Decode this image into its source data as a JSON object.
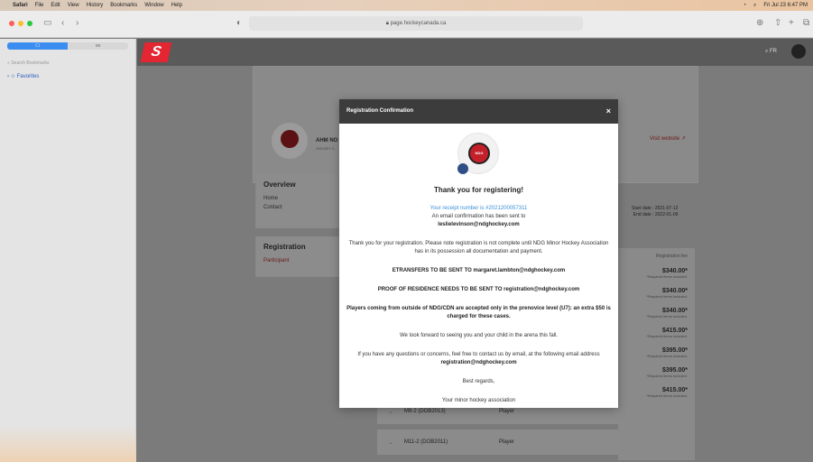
{
  "menubar": {
    "apple": "",
    "app_name": "Safari",
    "items": [
      "File",
      "Edit",
      "View",
      "History",
      "Bookmarks",
      "Window",
      "Help"
    ],
    "datetime": "Fri Jul 23  6:47 PM"
  },
  "browser": {
    "url": "page.hockeycanada.ca",
    "sidebar_tab_1": "☐",
    "sidebar_tab_2": "oo",
    "search_placeholder": "Search Bookmarks",
    "favorites": "Favorites"
  },
  "site": {
    "logo_text": "S",
    "lang": "FR",
    "club_name": "AHM NO",
    "club_sub": "HOCKEY C",
    "visit_link": "Visit website ↗",
    "overview_title": "Overview",
    "overview_items": [
      "Home",
      "Contact"
    ],
    "registration_title": "Registration",
    "registration_item": "Participant",
    "start_date": "Start date : 2021-07-12",
    "end_date": "End date : 2022-01-09",
    "fee_header": "Registration fee",
    "fees": [
      {
        "amount": "$340.00*",
        "note": "*Required items included."
      },
      {
        "amount": "$340.00*",
        "note": "*Required items included."
      },
      {
        "amount": "$340.00*",
        "note": "*Required items included."
      },
      {
        "amount": "$415.00*",
        "note": "*Required items included."
      },
      {
        "amount": "$395.00*",
        "note": "*Required items included."
      },
      {
        "amount": "$395.00*",
        "note": "*Required items included."
      },
      {
        "amount": "$415.00*",
        "note": "*Required items included."
      }
    ],
    "rows": [
      {
        "category": "M9-2 (DOB2013)",
        "role": "Player"
      },
      {
        "category": "M11-2 (DOB2011)",
        "role": "Player"
      }
    ]
  },
  "modal": {
    "title": "Registration Confirmation",
    "close": "×",
    "logo_text": "NDG",
    "thanks": "Thank you for registering!",
    "receipt": "Your receipt number is #2021200057311",
    "email_line": "An email confirmation has been sent to",
    "email": "leslielevinson@ndghockey.com",
    "note": "Thank you for your registration.  Please note registration is not complete until NDG Minor Hockey Association has in its possession all documentation and payment.",
    "etransfers": "ETRANSFERS TO BE SENT TO  margaret.lambton@ndghockey.com",
    "residence": "PROOF OF RESIDENCE NEEDS TO BE SENT TO registration@ndghockey.com",
    "players": "Players coming from outside of NDG/CDN are accepted only in the prenovice level (U7): an extra $50 is charged for these cases.",
    "forward": "We look forward to seeing you and your child in the arena this fall.",
    "questions": "If you have any questions or concerns, feel free to contact us by email, at the following email address",
    "questions_email": "registration@ndghockey.com",
    "regards": "Best regards,",
    "sign": "Your minor hockey association"
  }
}
